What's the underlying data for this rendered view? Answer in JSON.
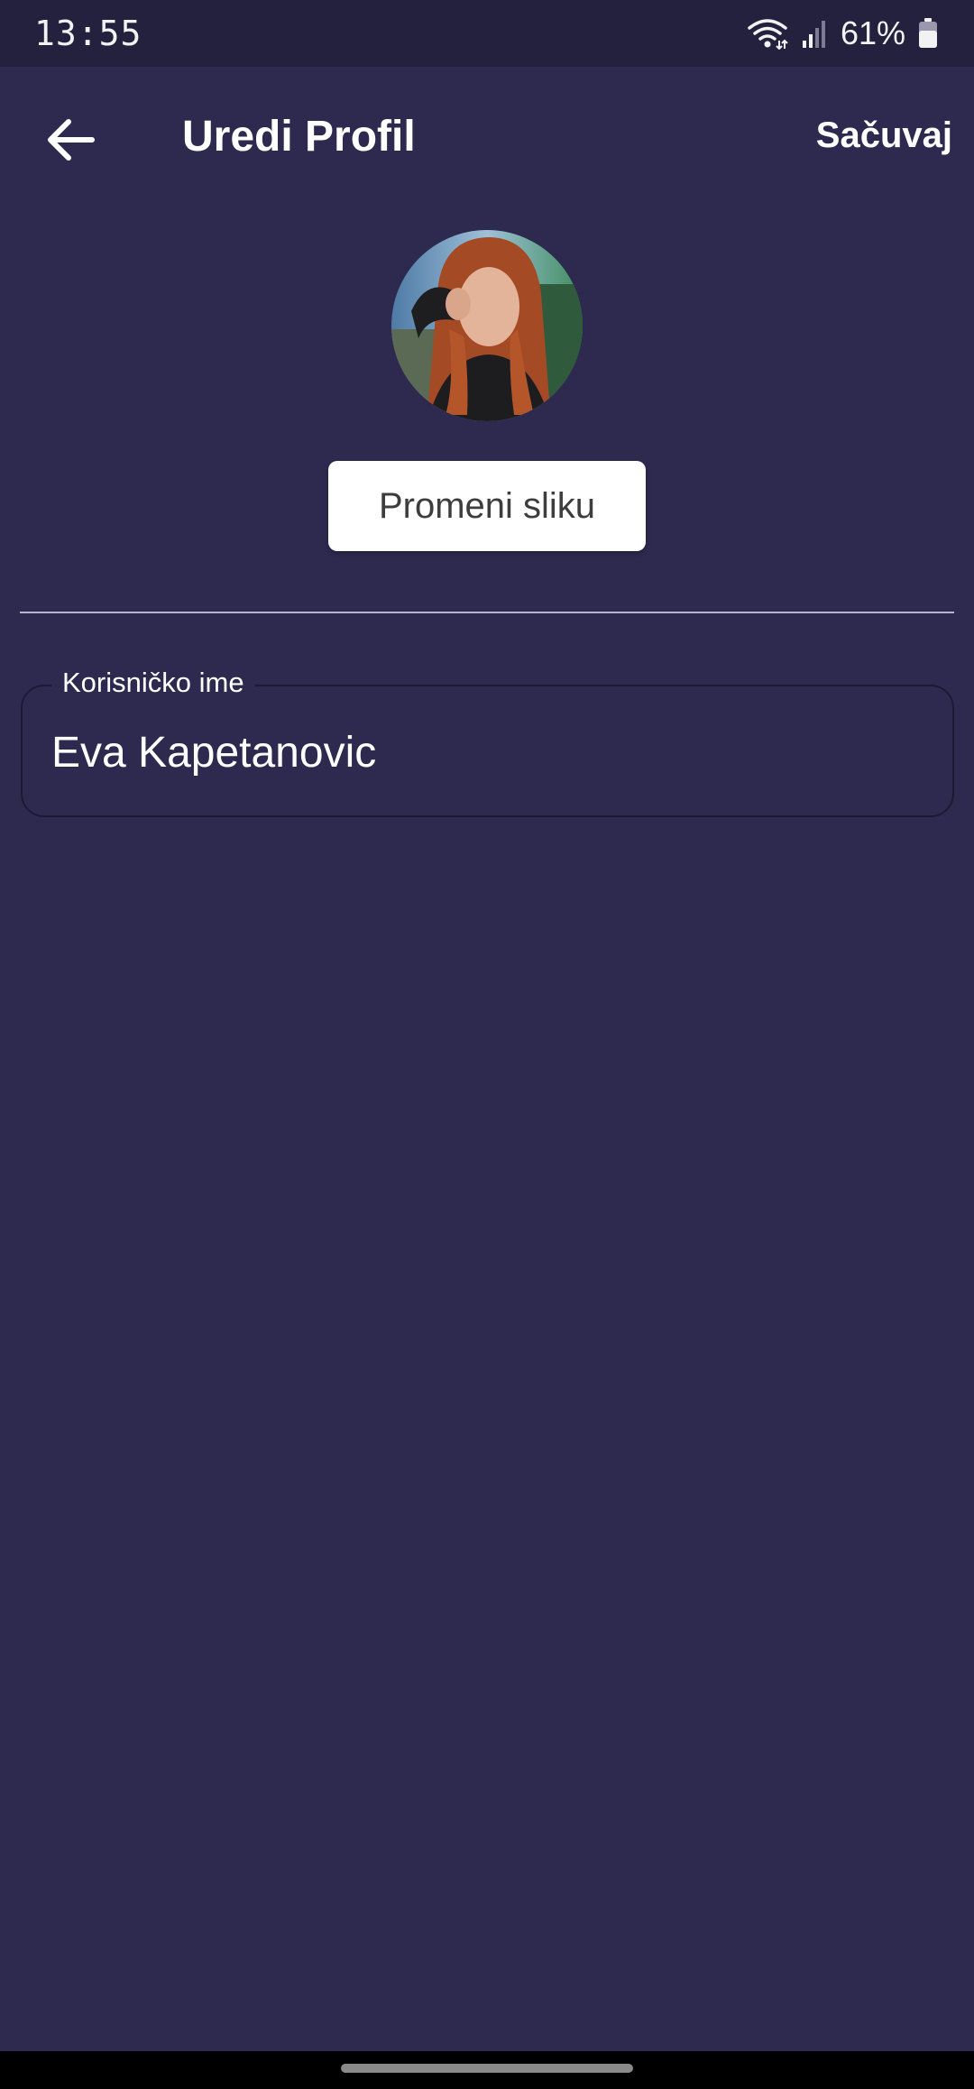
{
  "status_bar": {
    "time": "13:55",
    "battery_text": "61%",
    "icons": [
      "wifi-icon",
      "signal-icon",
      "battery-icon"
    ]
  },
  "app_bar": {
    "back_icon": "arrow-left-icon",
    "title": "Uredi Profil",
    "save_label": "Sačuvaj"
  },
  "profile": {
    "change_photo_label": "Promeni sliku"
  },
  "form": {
    "username_label": "Korisničko ime",
    "username_value": "Eva Kapetanovic"
  },
  "colors": {
    "background": "#2e2a4f",
    "status_bar": "#24213f",
    "button_bg": "#ffffff",
    "button_text": "#3d3d3d"
  }
}
